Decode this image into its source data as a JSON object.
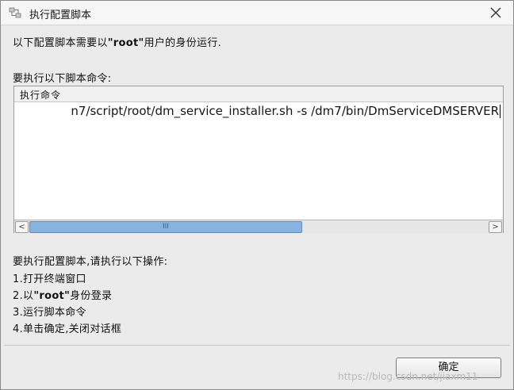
{
  "window": {
    "title": "执行配置脚本",
    "icon": "script-config-icon",
    "close_icon": "close-icon"
  },
  "description": {
    "prefix": "以下配置脚本需要以",
    "user": "\"root\"",
    "suffix": "用户的身份运行."
  },
  "commands_label": "要执行以下脚本命令:",
  "table": {
    "columns": [
      "执行命令"
    ],
    "rows": [
      [
        "n7/script/root/dm_service_installer.sh -s /dm7/bin/DmServiceDMSERVER"
      ]
    ],
    "scrollbar": {
      "left_arrow": "<",
      "right_arrow": ">",
      "thumb_grip": "III",
      "thumb_fraction": 0.59
    }
  },
  "instructions": {
    "heading": "要执行配置脚本,请执行以下操作:",
    "step1": "1.打开终端窗口",
    "step2_prefix": "2.以",
    "step2_user": "\"root\"",
    "step2_suffix": "身份登录",
    "step3": "3.运行脚本命令",
    "step4": "4.单击确定,关闭对话框"
  },
  "buttons": {
    "ok_label": "确定"
  },
  "watermark": "https://blog.csdn.net/jiaxm11"
}
